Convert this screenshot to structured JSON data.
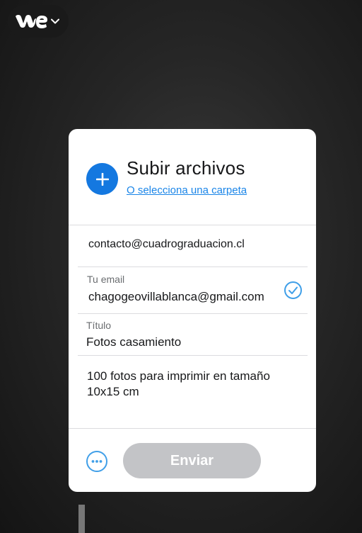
{
  "brand": {
    "logo_text": "we",
    "menu_icon": "chevron-down-icon"
  },
  "upload": {
    "plus_icon": "plus-icon",
    "title": "Subir archivos",
    "folder_link": "O selecciona una carpeta"
  },
  "form": {
    "to_email": "contacto@cuadrograduacion.cl",
    "your_email_label": "Tu email",
    "your_email_value": "chagogeovillablanca@gmail.com",
    "email_valid_icon": "check-circle-icon",
    "title_label": "Título",
    "title_value": "Fotos casamiento",
    "message_value": "100 fotos para imprimir en tamaño 10x15 cm"
  },
  "footer": {
    "more_icon": "more-options-icon",
    "send_label": "Enviar"
  },
  "colors": {
    "accent": "#1478e0",
    "link": "#1a85e8",
    "send_disabled": "#c3c4c7",
    "check": "#409fe8"
  }
}
